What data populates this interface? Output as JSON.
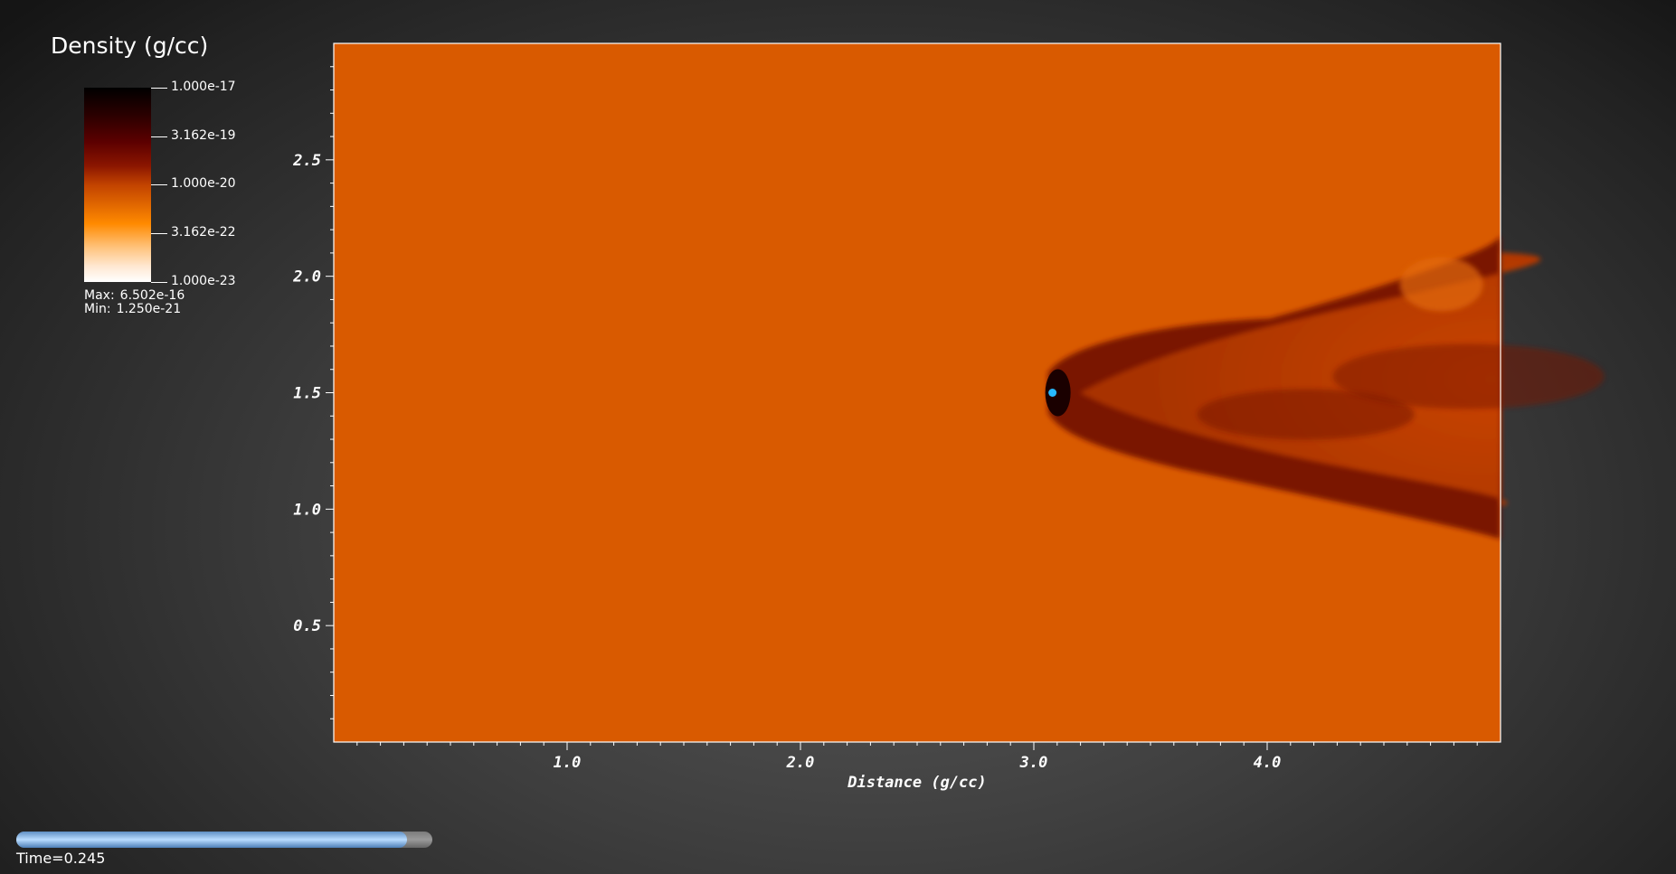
{
  "legend": {
    "title": "Density (g/cc)",
    "ticks": [
      "1.000e-17",
      "3.162e-19",
      "1.000e-20",
      "3.162e-22",
      "1.000e-23"
    ],
    "max_label": "Max:",
    "max_value": "6.502e-16",
    "min_label": "Min:",
    "min_value": "1.250e-21"
  },
  "colors": {
    "background": "#d95a00",
    "wake_dark": "#7a1600",
    "wake_mid": "#b53a00",
    "wake_light": "#cc4a00",
    "star": "#27b9ff"
  },
  "chart_data": {
    "type": "heatmap",
    "title": "",
    "xlabel": "Distance (g/cc)",
    "ylabel": "",
    "xlim": [
      0,
      5.0
    ],
    "ylim": [
      0,
      3.0
    ],
    "x_ticks": [
      "1.0",
      "2.0",
      "3.0",
      "4.0"
    ],
    "y_ticks": [
      "0.5",
      "1.0",
      "1.5",
      "2.0",
      "2.5"
    ],
    "grid": false,
    "colormap": "black-red-orange-white (log scale)",
    "source_point": {
      "x": 3.08,
      "y": 1.5
    }
  },
  "time": {
    "label": "Time=0.245",
    "progress": 0.94
  }
}
